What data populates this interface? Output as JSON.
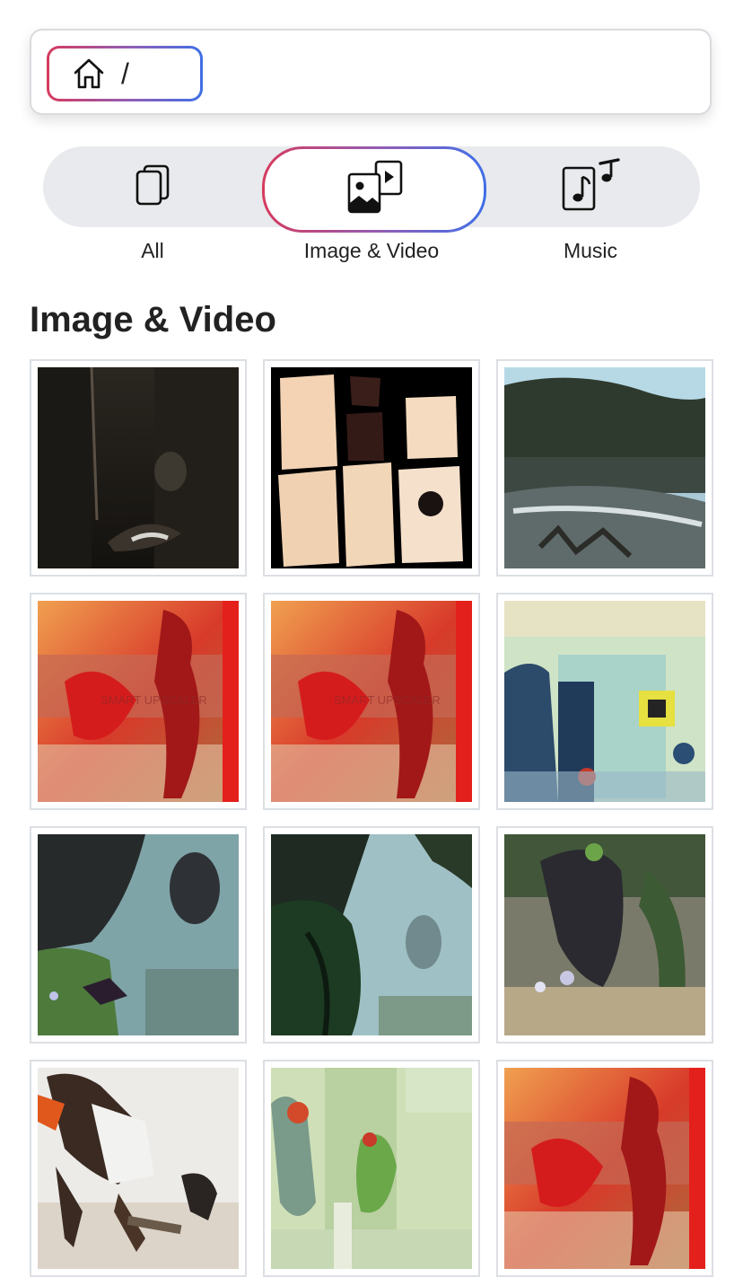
{
  "breadcrumb": {
    "home_icon": "home-icon",
    "separator": "/"
  },
  "tabs": [
    {
      "label": "All",
      "icon": "documents-icon",
      "selected": false
    },
    {
      "label": "Image & Video",
      "icon": "image-video-icon",
      "selected": true
    },
    {
      "label": "Music",
      "icon": "music-file-icon",
      "selected": false
    }
  ],
  "accent_gradient": [
    "#d63b5e",
    "#8e5fb8",
    "#3f6fe6"
  ],
  "section": {
    "title": "Image & Video"
  },
  "gallery": {
    "items": [
      {
        "name": "dark-interior-thumbnail"
      },
      {
        "name": "paper-texture-thumbnail"
      },
      {
        "name": "landscape-thumbnail"
      },
      {
        "name": "red-abstract-thumbnail",
        "watermark": "SMART UPSCALER"
      },
      {
        "name": "red-abstract-thumbnail",
        "watermark": "SMART UPSCALER"
      },
      {
        "name": "colorful-abstract-thumbnail"
      },
      {
        "name": "green-abstract-thumbnail"
      },
      {
        "name": "green-abstract-thumbnail"
      },
      {
        "name": "green-abstract-thumbnail"
      },
      {
        "name": "figures-thumbnail"
      },
      {
        "name": "pale-abstract-thumbnail"
      },
      {
        "name": "red-abstract-thumbnail"
      }
    ]
  }
}
